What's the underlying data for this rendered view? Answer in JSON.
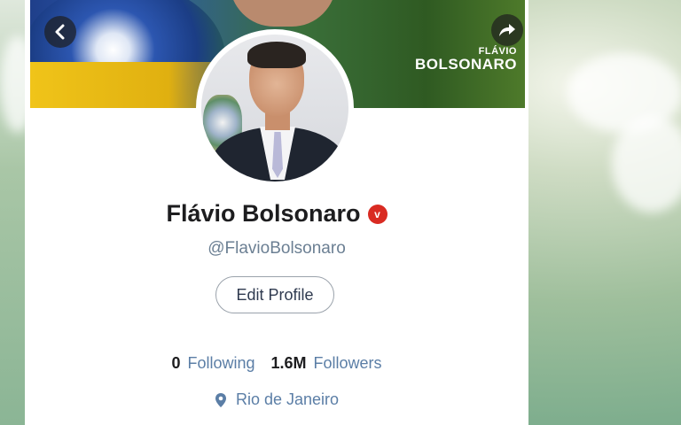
{
  "profile": {
    "display_name": "Flávio Bolsonaro",
    "verified_icon": "verified-badge-icon",
    "verified_mark": "v",
    "handle": "@FlavioBolsonaro",
    "edit_button_label": "Edit Profile",
    "stats": [
      {
        "value": "0",
        "label": "Following"
      },
      {
        "value": "1.6M",
        "label": "Followers"
      }
    ],
    "location": "Rio de Janeiro"
  },
  "banner": {
    "brand_line1": "FLÁVIO",
    "brand_line2": "BOLSONARO",
    "back_icon": "chevron-left-icon",
    "share_icon": "share-arrow-icon"
  },
  "colors": {
    "link_blue": "#5b7ea6",
    "verified_red": "#d92b22",
    "text_dark": "#1d1d1f"
  }
}
